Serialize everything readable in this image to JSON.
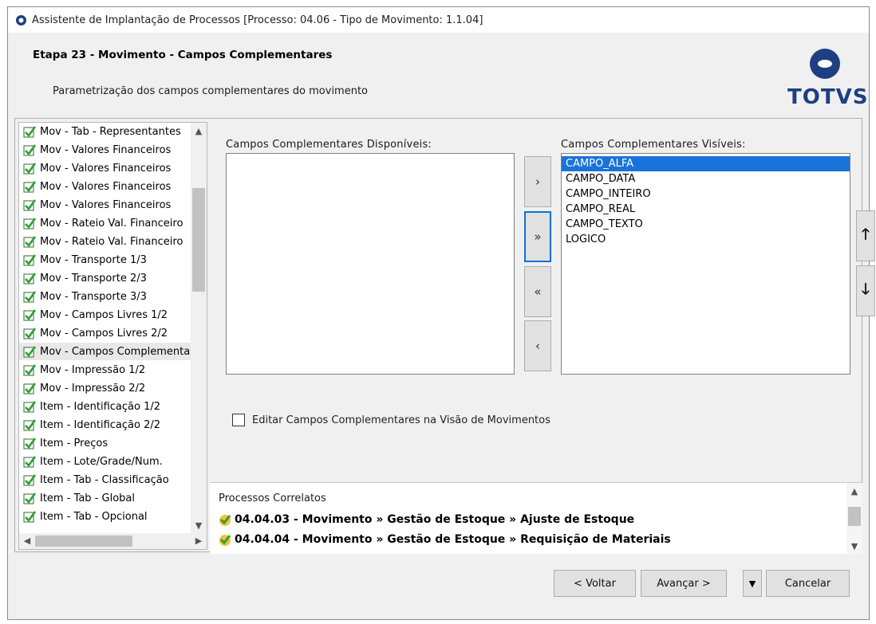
{
  "window": {
    "title": "Assistente de Implantação de Processos [Processo: 04.06 - Tipo de Movimento: 1.1.04]",
    "icon": "circle-logo-icon"
  },
  "header": {
    "step_title": "Etapa 23 - Movimento - Campos Complementares",
    "step_subtitle": "Parametrização dos campos complementares do movimento",
    "logo_text": "TOTVS",
    "brand_color": "#1e3f82"
  },
  "steps": {
    "items": [
      {
        "label": "Mov - Tab - Representantes"
      },
      {
        "label": "Mov - Valores Financeiros"
      },
      {
        "label": "Mov - Valores Financeiros"
      },
      {
        "label": "Mov - Valores Financeiros"
      },
      {
        "label": "Mov - Valores Financeiros"
      },
      {
        "label": "Mov - Rateio Val. Financeiro"
      },
      {
        "label": "Mov - Rateio Val. Financeiro"
      },
      {
        "label": "Mov - Transporte 1/3"
      },
      {
        "label": "Mov - Transporte 2/3"
      },
      {
        "label": "Mov - Transporte 3/3"
      },
      {
        "label": "Mov - Campos Livres 1/2"
      },
      {
        "label": "Mov - Campos Livres 2/2"
      },
      {
        "label": "Mov - Campos Complementares"
      },
      {
        "label": "Mov - Impressão 1/2"
      },
      {
        "label": "Mov - Impressão 2/2"
      },
      {
        "label": "Item - Identificação 1/2"
      },
      {
        "label": "Item - Identificação 2/2"
      },
      {
        "label": "Item - Preços"
      },
      {
        "label": "Item - Lote/Grade/Num."
      },
      {
        "label": "Item - Tab - Classificação"
      },
      {
        "label": "Item - Tab - Global"
      },
      {
        "label": "Item - Tab - Opcional"
      }
    ]
  },
  "available": {
    "label": "Campos Complementares Disponíveis:",
    "items": []
  },
  "visible": {
    "label": "Campos Complementares Visíveis:",
    "items": [
      "CAMPO_ALFA",
      "CAMPO_DATA",
      "CAMPO_INTEIRO",
      "CAMPO_REAL",
      "CAMPO_TEXTO",
      "LOGICO"
    ]
  },
  "move_buttons": {
    "add_one": "›",
    "add_all": "»",
    "remove_all": "«",
    "remove_one": "‹"
  },
  "order_buttons": {
    "up": "🡑",
    "down": "🡓"
  },
  "checkbox": {
    "label": "Editar Campos Complementares na Visão de Movimentos"
  },
  "correlated": {
    "title": "Processos Correlatos",
    "items": [
      "04.04.03 - Movimento » Gestão de Estoque » Ajuste de Estoque",
      "04.04.04 - Movimento » Gestão de Estoque » Requisição de Materiais"
    ]
  },
  "footer": {
    "back": "< Voltar",
    "next": "Avançar >",
    "cancel": "Cancelar"
  },
  "colors": {
    "selection": "#1a73d9",
    "focus_border": "#0a72d6",
    "check_green": "#2e9e3a"
  }
}
